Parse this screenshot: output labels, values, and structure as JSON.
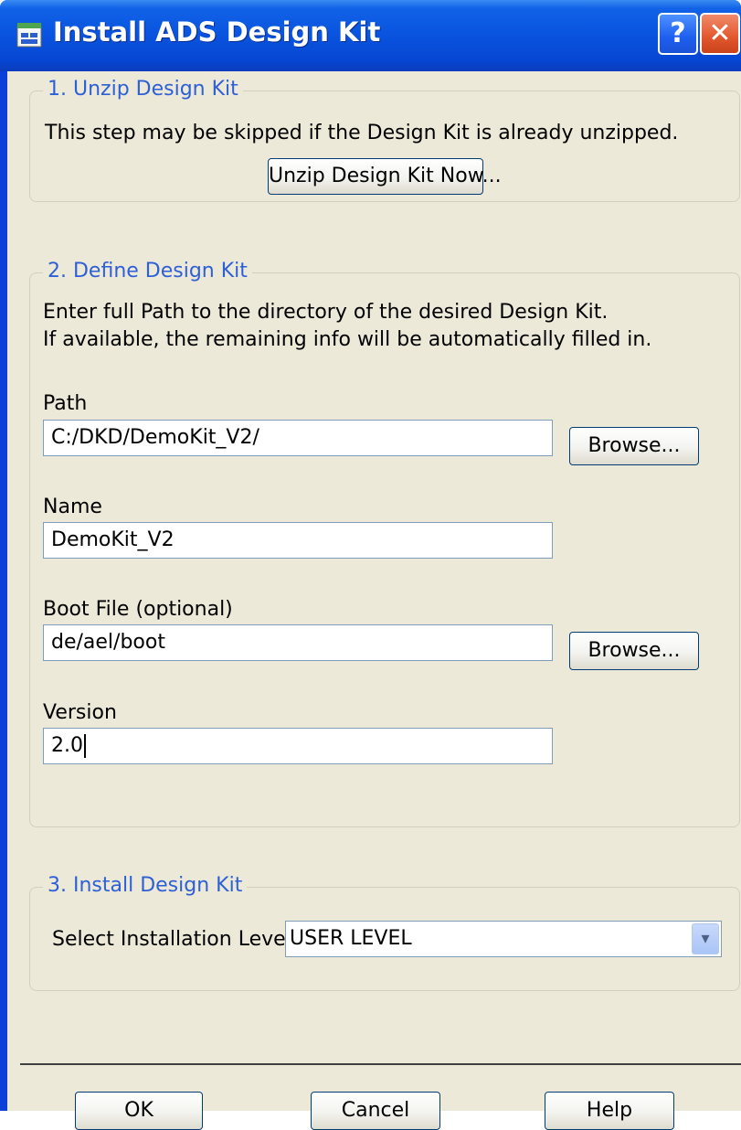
{
  "window": {
    "title": "Install ADS Design Kit",
    "help_glyph": "?",
    "close_glyph": "✕"
  },
  "section1": {
    "legend": "1. Unzip Design Kit",
    "description": "This step may be skipped if the Design Kit is already unzipped.",
    "unzip_button": "Unzip Design Kit Now..."
  },
  "section2": {
    "legend": "2. Define Design Kit",
    "description_line1": "Enter full Path to the directory of the desired Design Kit.",
    "description_line2": "If available, the remaining info will be automatically filled in.",
    "path_label": "Path",
    "path_value": "C:/DKD/DemoKit_V2/",
    "browse_label": "Browse...",
    "name_label": "Name",
    "name_value": "DemoKit_V2",
    "boot_label": "Boot File (optional)",
    "boot_value": "de/ael/boot",
    "version_label": "Version",
    "version_value": "2.0"
  },
  "section3": {
    "legend": "3. Install Design Kit",
    "level_label": "Select Installation Level :",
    "level_value": "USER LEVEL",
    "dropdown_glyph": "▾"
  },
  "footer": {
    "ok": "OK",
    "cancel": "Cancel",
    "help": "Help"
  }
}
